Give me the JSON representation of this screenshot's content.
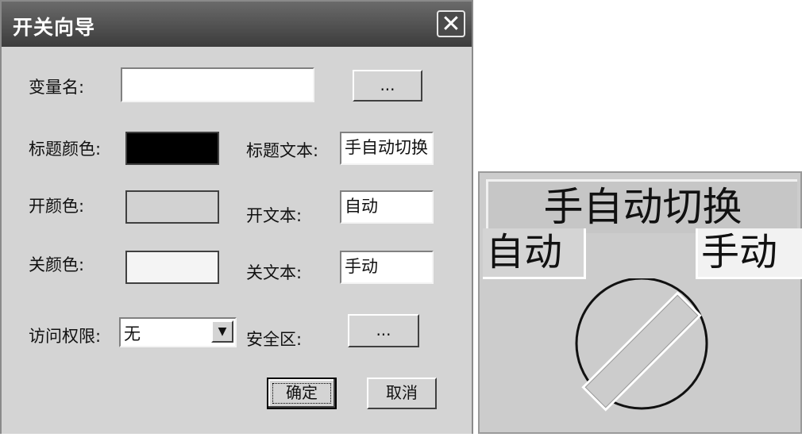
{
  "window": {
    "title": "开关向导",
    "close_icon": "close-icon"
  },
  "form": {
    "variable_name": {
      "label": "变量名:",
      "value": "",
      "browse_label": "..."
    },
    "title_color": {
      "label": "标题颜色:",
      "color": "#000000"
    },
    "title_text": {
      "label": "标题文本:",
      "value": "手自动切换"
    },
    "on_color": {
      "label": "开颜色:",
      "color": "#d2d2d2"
    },
    "on_text": {
      "label": "开文本:",
      "value": "自动"
    },
    "off_color": {
      "label": "关颜色:",
      "color": "#f4f4f4"
    },
    "off_text": {
      "label": "关文本:",
      "value": "手动"
    },
    "access_level": {
      "label": "访问权限:",
      "selected": "无"
    },
    "safe_zone": {
      "label": "安全区:",
      "browse_label": "..."
    }
  },
  "buttons": {
    "ok": "确定",
    "cancel": "取消"
  },
  "preview": {
    "title": "手自动切换",
    "on_text": "自动",
    "off_text": "手动",
    "state": "off"
  }
}
